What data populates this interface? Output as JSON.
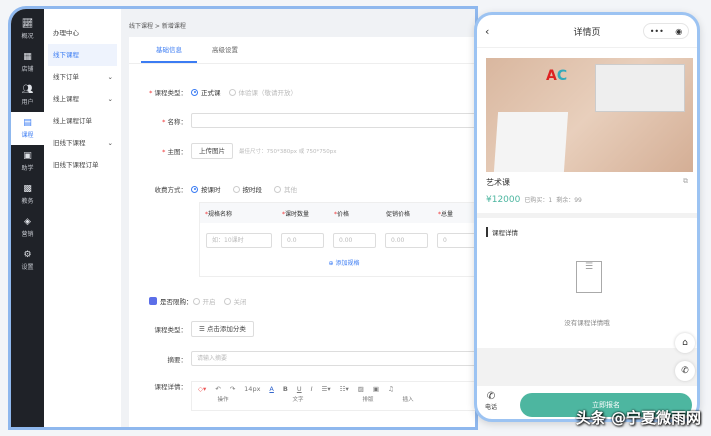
{
  "sidebar": {
    "items": [
      {
        "label": "概况",
        "icon": "chart"
      },
      {
        "label": "店铺",
        "icon": "store"
      },
      {
        "label": "用户",
        "icon": "users"
      },
      {
        "label": "课程",
        "icon": "doc"
      },
      {
        "label": "助学",
        "icon": "study"
      },
      {
        "label": "教务",
        "icon": "affairs"
      },
      {
        "label": "营销",
        "icon": "tag"
      },
      {
        "label": "设置",
        "icon": "gear"
      }
    ]
  },
  "submenu": {
    "items": [
      {
        "label": "办理中心"
      },
      {
        "label": "线下课程"
      },
      {
        "label": "线下订单"
      },
      {
        "label": "线上课程"
      },
      {
        "label": "线上课程订单"
      },
      {
        "label": "旧线下课程"
      },
      {
        "label": "旧线下课程订单"
      }
    ]
  },
  "breadcrumb": "线下课程 > 新增课程",
  "tabs": [
    "基础信息",
    "高级设置"
  ],
  "form": {
    "type_label": "课程类型：",
    "type_opt1": "正式课",
    "type_opt2": "体验课（敬请开放）",
    "name_label": "名称：",
    "cover_label": "主图：",
    "upload": "上传图片",
    "cover_hint": "最佳尺寸：750*380px 或 750*750px",
    "charge_label": "收费方式：",
    "charge_opt1": "按课时",
    "charge_opt2": "按时段",
    "charge_opt3": "其他",
    "spec_headers": [
      "规格名称",
      "课时数量",
      "价格",
      "促销价格",
      "总量"
    ],
    "spec_values": [
      "如：10课时",
      "0.0",
      "0.00",
      "0.00",
      "0"
    ],
    "add_spec": "添加规格",
    "limit_label": "是否限购：",
    "limit_opt1": "开启",
    "limit_opt2": "关闭",
    "cat_label": "课程类型：",
    "cat_btn": "点击添加分类",
    "summary_label": "摘要：",
    "summary_placeholder": "请输入摘要",
    "detail_label": "课程详情：",
    "font_size": "14px",
    "toolbar_groups": [
      "操作",
      "文字",
      "排版",
      "插入"
    ]
  },
  "phone": {
    "title": "详情页",
    "course": "艺术课",
    "price": "¥12000",
    "sold": "已购买：1",
    "left": "剩余：99",
    "section": "课程详情",
    "empty": "没有课程详情哦",
    "call": "电话",
    "signup": "立即报名"
  },
  "watermark": "头条 @宁夏微雨网",
  "colors": {
    "accent": "#3b7cf3",
    "green": "#4db6a0",
    "sidebar": "#1f2228"
  }
}
